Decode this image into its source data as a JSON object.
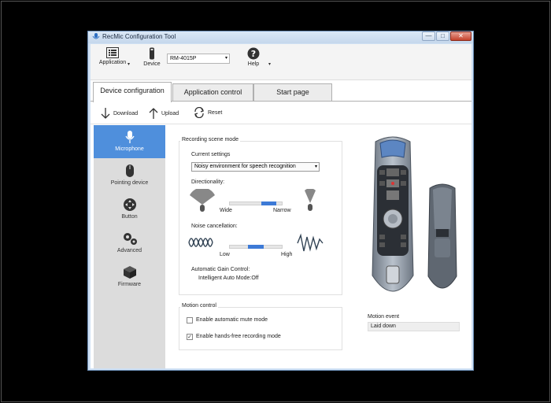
{
  "window": {
    "title": "RecMic Configuration Tool",
    "min": "—",
    "max": "□",
    "close": "✕"
  },
  "toolbar": {
    "application_label": "Application",
    "device_label": "Device",
    "device_value": "RM-4015P",
    "help_label": "Help"
  },
  "tabs": [
    {
      "label": "Device configuration"
    },
    {
      "label": "Application control"
    },
    {
      "label": "Start page"
    }
  ],
  "actions": {
    "download": "Download",
    "upload": "Upload",
    "reset": "Reset"
  },
  "sidebar": {
    "items": [
      {
        "label": "Microphone",
        "icon": "microphone-icon"
      },
      {
        "label": "Pointing device",
        "icon": "mouse-icon"
      },
      {
        "label": "Button",
        "icon": "dpad-icon"
      },
      {
        "label": "Advanced",
        "icon": "gears-icon"
      },
      {
        "label": "Firmware",
        "icon": "cube-icon"
      }
    ]
  },
  "recording": {
    "group_title": "Recording scene mode",
    "current_settings_label": "Current settings",
    "current_settings_value": "Noisy environment for speech recognition",
    "directionality_label": "Directionality:",
    "dir_low": "Wide",
    "dir_high": "Narrow",
    "directionality_value": 0.75,
    "noise_label": "Noise cancellation:",
    "noise_low": "Low",
    "noise_high": "High",
    "noise_value": 0.5,
    "agc_label": "Automatic Gain Control:",
    "agc_value": "Intelligent Auto Mode:Off"
  },
  "motion": {
    "group_title": "Motion control",
    "auto_mute_label": "Enable automatic mute mode",
    "auto_mute_checked": false,
    "handsfree_label": "Enable hands-free recording mode",
    "handsfree_checked": true,
    "event_label": "Motion event",
    "event_value": "Laid down"
  },
  "colors": {
    "accent": "#4f8fdc",
    "slider_fill": "#3d7ad6",
    "sidebar_bg": "#dcdcdc"
  }
}
